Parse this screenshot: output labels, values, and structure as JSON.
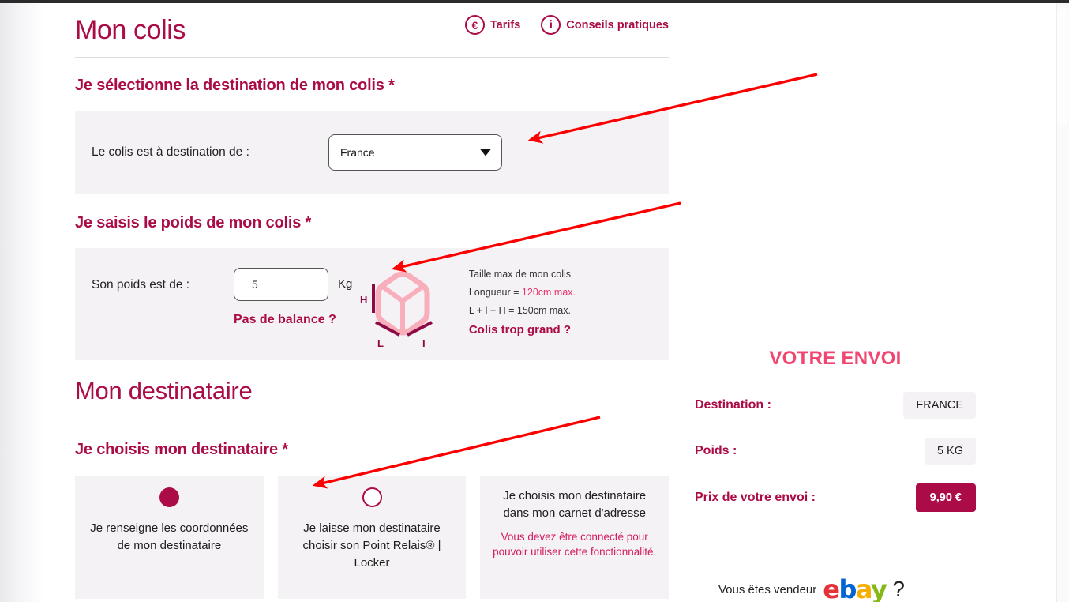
{
  "header": {
    "title": "Mon colis",
    "links": [
      {
        "icon": "euro-icon",
        "glyph": "€",
        "label": "Tarifs"
      },
      {
        "icon": "info-icon",
        "glyph": "i",
        "label": "Conseils pratiques"
      }
    ]
  },
  "destination_section": {
    "heading": "Je sélectionne la destination de mon colis *",
    "field_label": "Le colis est à destination de :",
    "select_value": "France",
    "caret_icon": "chevron-down-icon"
  },
  "weight_section": {
    "heading": "Je saisis le poids de mon colis *",
    "field_label": "Son poids est de :",
    "input_value": "5",
    "input_placeholder": "",
    "unit": "Kg",
    "no_scale_link": "Pas de balance ?",
    "box_labels": {
      "height": "H",
      "length": "L",
      "width": "I"
    },
    "size_title": "Taille max de mon colis",
    "size_line2_prefix": "Longueur = ",
    "size_line2_value": "120cm max.",
    "size_line3": "L + l + H = 150cm max.",
    "too_big_link": "Colis trop grand ?"
  },
  "recipient_section": {
    "big_title": "Mon destinataire",
    "heading": "Je choisis mon destinataire *",
    "cards": [
      {
        "selected": true,
        "text": "Je renseigne les coordonnées de mon destinataire",
        "note": ""
      },
      {
        "selected": false,
        "text": "Je laisse mon destinataire choisir son Point Relais® | Locker",
        "note": ""
      },
      {
        "selected": null,
        "text": "Je choisis mon destinataire dans mon carnet d'adresse",
        "note": "Vous devez être connecté pour pouvoir utiliser cette fonctionnalité."
      }
    ]
  },
  "sidebar": {
    "title": "VOTRE ENVOI",
    "rows": [
      {
        "label": "Destination :",
        "value": "FRANCE"
      },
      {
        "label": "Poids :",
        "value": "5 KG"
      },
      {
        "label": "Prix de votre envoi :",
        "value": "9,90 €"
      }
    ]
  },
  "ebay_promo": {
    "text": "Vous êtes vendeur",
    "logo_letters": [
      "e",
      "b",
      "a",
      "y"
    ],
    "question_mark": "?"
  },
  "colors": {
    "brand_maroon": "#ab0b46",
    "brand_pink": "#e8336d",
    "panel_bg": "#f4f2f4",
    "annotation_red": "#fc0000"
  }
}
